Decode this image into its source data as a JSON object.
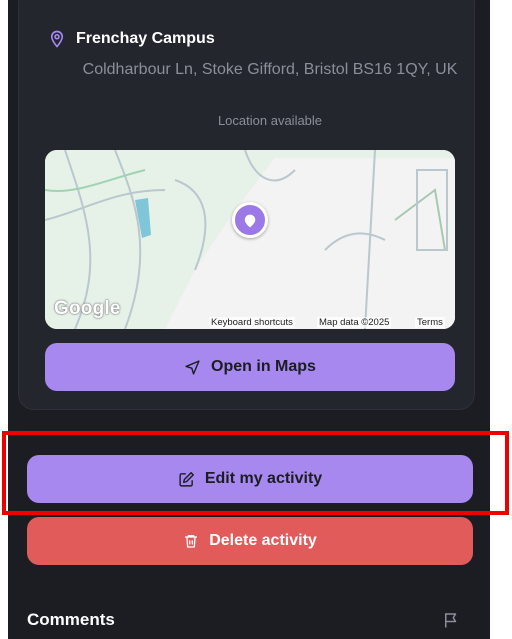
{
  "location": {
    "name": "Frenchay Campus",
    "address": "Coldharbour Ln, Stoke Gifford, Bristol BS16 1QY, UK",
    "status": "Location available"
  },
  "map": {
    "logo": "Google",
    "shortcuts": "Keyboard shortcuts",
    "data": "Map data ©2025",
    "terms": "Terms"
  },
  "actions": {
    "open_maps": "Open in Maps",
    "edit": "Edit my activity",
    "delete": "Delete activity"
  },
  "comments": {
    "title": "Comments"
  },
  "colors": {
    "accent": "#a688ee",
    "danger": "#e15b5b",
    "background": "#1b1d22",
    "highlight": "#ee0000"
  },
  "icons": [
    "location-pin-icon",
    "map-marker-icon",
    "navigation-arrow-icon",
    "edit-icon",
    "trash-icon",
    "flag-icon"
  ]
}
